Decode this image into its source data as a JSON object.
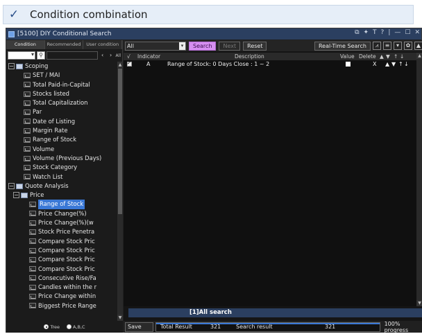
{
  "banner": {
    "title": "Condition combination"
  },
  "window": {
    "title": "[5100] DIY Conditional Search",
    "controls": [
      "⧉",
      "✦",
      "T",
      "?",
      "|",
      "—",
      "☐",
      "✕"
    ]
  },
  "left": {
    "tabs": [
      "Condition",
      "Recommended",
      "User condition"
    ],
    "search": {
      "all_label": "All"
    },
    "tree": [
      {
        "label": "Scoping",
        "type": "folder",
        "level": 0,
        "expander": "−"
      },
      {
        "label": "SET / MAI",
        "type": "leaf",
        "level": 2
      },
      {
        "label": "Total Paid-in-Capital",
        "type": "leaf",
        "level": 2
      },
      {
        "label": "Stocks listed",
        "type": "leaf",
        "level": 2
      },
      {
        "label": "Total Capitalization",
        "type": "leaf",
        "level": 2
      },
      {
        "label": "Par",
        "type": "leaf",
        "level": 2
      },
      {
        "label": "Date of Listing",
        "type": "leaf",
        "level": 2
      },
      {
        "label": "Margin Rate",
        "type": "leaf",
        "level": 2
      },
      {
        "label": "Range of Stock",
        "type": "leaf",
        "level": 2
      },
      {
        "label": "Volume",
        "type": "leaf",
        "level": 2
      },
      {
        "label": "Volume (Previous Days)",
        "type": "leaf",
        "level": 2
      },
      {
        "label": "Stock Category",
        "type": "leaf",
        "level": 2
      },
      {
        "label": "Watch List",
        "type": "leaf",
        "level": 2
      },
      {
        "label": "Quote Analysis",
        "type": "folder",
        "level": 0,
        "expander": "−"
      },
      {
        "label": "Price",
        "type": "folder",
        "level": 1,
        "expander": "−"
      },
      {
        "label": "Range of Stock",
        "type": "leaf",
        "level": 3,
        "selected": true
      },
      {
        "label": "Price Change(%)",
        "type": "leaf",
        "level": 3
      },
      {
        "label": "Price Change(%)(w",
        "type": "leaf",
        "level": 3
      },
      {
        "label": "Stock Price Penetra",
        "type": "leaf",
        "level": 3
      },
      {
        "label": "Compare Stock Pric",
        "type": "leaf",
        "level": 3
      },
      {
        "label": "Compare Stock Pric",
        "type": "leaf",
        "level": 3
      },
      {
        "label": "Compare Stock Pric",
        "type": "leaf",
        "level": 3
      },
      {
        "label": "Compare Stock Pric",
        "type": "leaf",
        "level": 3
      },
      {
        "label": "Consecutive Rise/Fa",
        "type": "leaf",
        "level": 3
      },
      {
        "label": "Candles within the r",
        "type": "leaf",
        "level": 3
      },
      {
        "label": "Price Change within",
        "type": "leaf",
        "level": 3
      },
      {
        "label": "Biggest Price Range",
        "type": "leaf",
        "level": 3
      }
    ],
    "view_options": [
      {
        "label": "Tree",
        "checked": true
      },
      {
        "label": "A,B,C",
        "checked": false
      }
    ]
  },
  "toolbar": {
    "scope_value": "All",
    "search_label": "Search",
    "next_label": "Next",
    "reset_label": "Reset",
    "realtime_label": "Real-Time Search"
  },
  "grid": {
    "headers": {
      "check": "√",
      "indicator": "Indicator",
      "description": "Description",
      "value": "Value",
      "delete": "Delete"
    },
    "rows": [
      {
        "indicator": "A",
        "description": "Range of Stock: 0 Days Close : 1 ~ 2",
        "delete": "X"
      }
    ]
  },
  "result_tab": {
    "label": "[1]All search"
  },
  "status": {
    "save_fav": "Save Fav",
    "total_result_label": "Total Result",
    "total_result_value": "321",
    "search_result_label": "Search result",
    "search_result_value": "321",
    "progress_text": "100% progress",
    "progress": 1.0
  }
}
